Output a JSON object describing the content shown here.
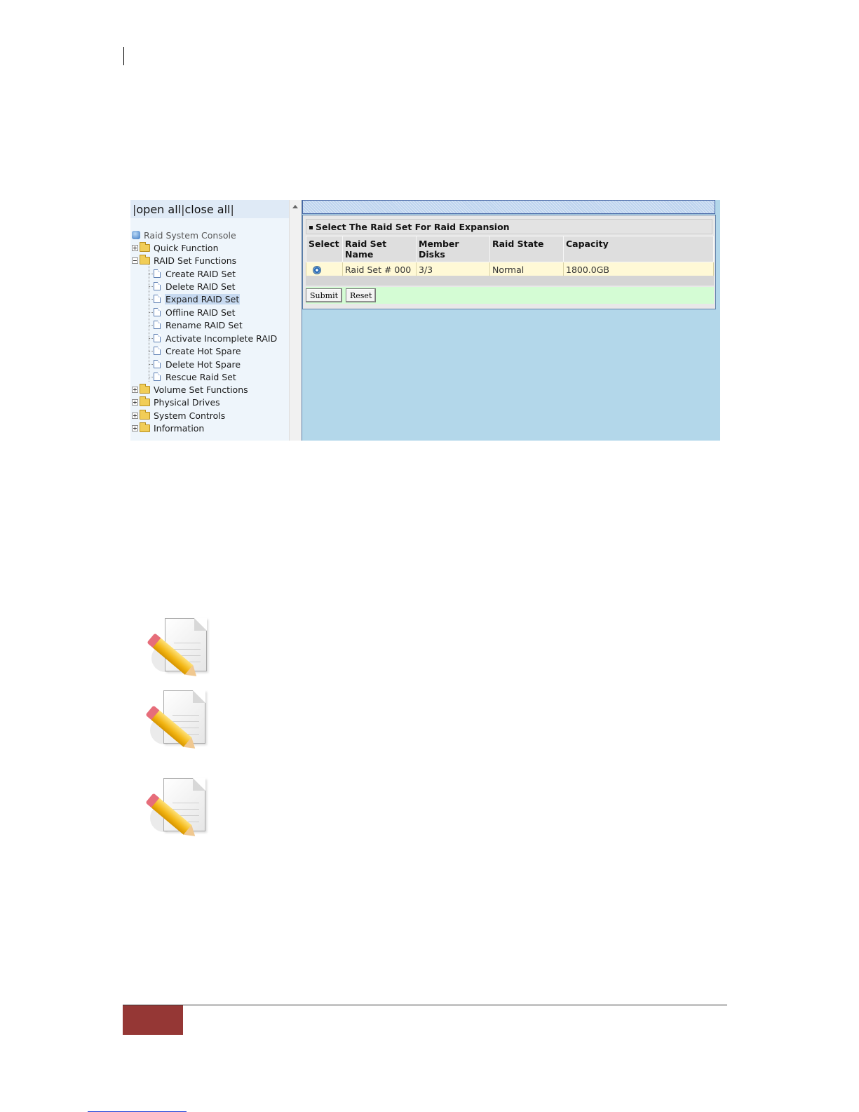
{
  "tree_header": {
    "sep": "|",
    "open_all": "open all",
    "close_all": "close all"
  },
  "tree": {
    "root": "Raid System Console",
    "quick_function": "Quick Function",
    "raid_set_functions": "RAID Set Functions",
    "raid_children": [
      "Create RAID Set",
      "Delete RAID Set",
      "Expand RAID Set",
      "Offline RAID Set",
      "Rename RAID Set",
      "Activate Incomplete RAID",
      "Create Hot Spare",
      "Delete Hot Spare",
      "Rescue Raid Set"
    ],
    "selected": "Expand RAID Set",
    "volume_set_functions": "Volume Set Functions",
    "physical_drives": "Physical Drives",
    "system_controls": "System Controls",
    "information": "Information"
  },
  "panel": {
    "title": "Select The Raid Set For Raid Expansion",
    "columns": [
      "Select",
      "Raid Set Name",
      "Member Disks",
      "Raid State",
      "Capacity"
    ],
    "rows": [
      {
        "selected": true,
        "name": "Raid Set # 000",
        "member_disks": "3/3",
        "state": "Normal",
        "capacity": "1800.0GB"
      }
    ],
    "submit_label": "Submit",
    "reset_label": "Reset"
  },
  "colors": {
    "content_bg": "#b3d7ea",
    "row_bg": "#fff9d6",
    "button_row_bg": "#d4fcd4",
    "footer_block": "#953735"
  },
  "icons": [
    "note-pencil-icon",
    "note-pencil-icon",
    "note-pencil-icon"
  ]
}
